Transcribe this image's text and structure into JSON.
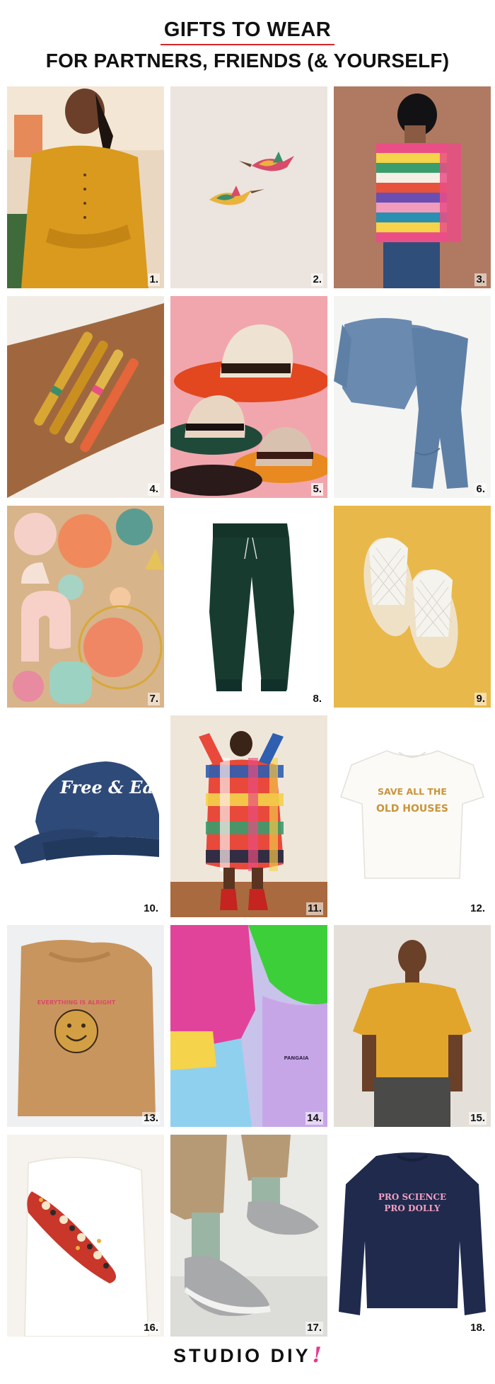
{
  "header": {
    "title_line1": "GIFTS TO WEAR",
    "title_line2": "FOR PARTNERS, FRIENDS (& YOURSELF)",
    "accent_color": "#d8262b"
  },
  "items": [
    {
      "number": "1.",
      "icon": "mustard-knit-set-photo"
    },
    {
      "number": "2.",
      "icon": "hummingbird-earrings-photo"
    },
    {
      "number": "3.",
      "icon": "rainbow-stripe-sweater-photo"
    },
    {
      "number": "4.",
      "icon": "beaded-bracelets-photo"
    },
    {
      "number": "5.",
      "icon": "stacked-hats-photo"
    },
    {
      "number": "6.",
      "icon": "blue-waffle-lounge-set-photo"
    },
    {
      "number": "7.",
      "icon": "clay-earrings-photo"
    },
    {
      "number": "8.",
      "icon": "green-sweatpants-photo"
    },
    {
      "number": "9.",
      "icon": "woven-white-mules-photo"
    },
    {
      "number": "10.",
      "icon": "denim-cap-photo"
    },
    {
      "number": "11.",
      "icon": "plaid-shirt-dress-photo"
    },
    {
      "number": "12.",
      "icon": "old-houses-tee-photo"
    },
    {
      "number": "13.",
      "icon": "smiley-sweatshirt-photo"
    },
    {
      "number": "14.",
      "icon": "colorful-sweats-photo"
    },
    {
      "number": "15.",
      "icon": "mustard-terry-tee-photo"
    },
    {
      "number": "16.",
      "icon": "rug-fanny-pack-photo"
    },
    {
      "number": "17.",
      "icon": "wool-slip-on-sneakers-photo"
    },
    {
      "number": "18.",
      "icon": "pro-science-sweatshirt-photo"
    }
  ],
  "photo_text": {
    "cap": "Free & Easy",
    "tee": [
      "SAVE ALL THE",
      "OLD HOUSES"
    ],
    "sweatshirt13": "EVERYTHING IS ALRIGHT",
    "pants14": "PANGAIA",
    "sweatshirt18": [
      "PRO SCIENCE",
      "PRO DOLLY"
    ]
  },
  "footer": {
    "brand": "STUDIO DIY",
    "brand_mark": "!",
    "brand_mark_color": "#e4388f"
  }
}
